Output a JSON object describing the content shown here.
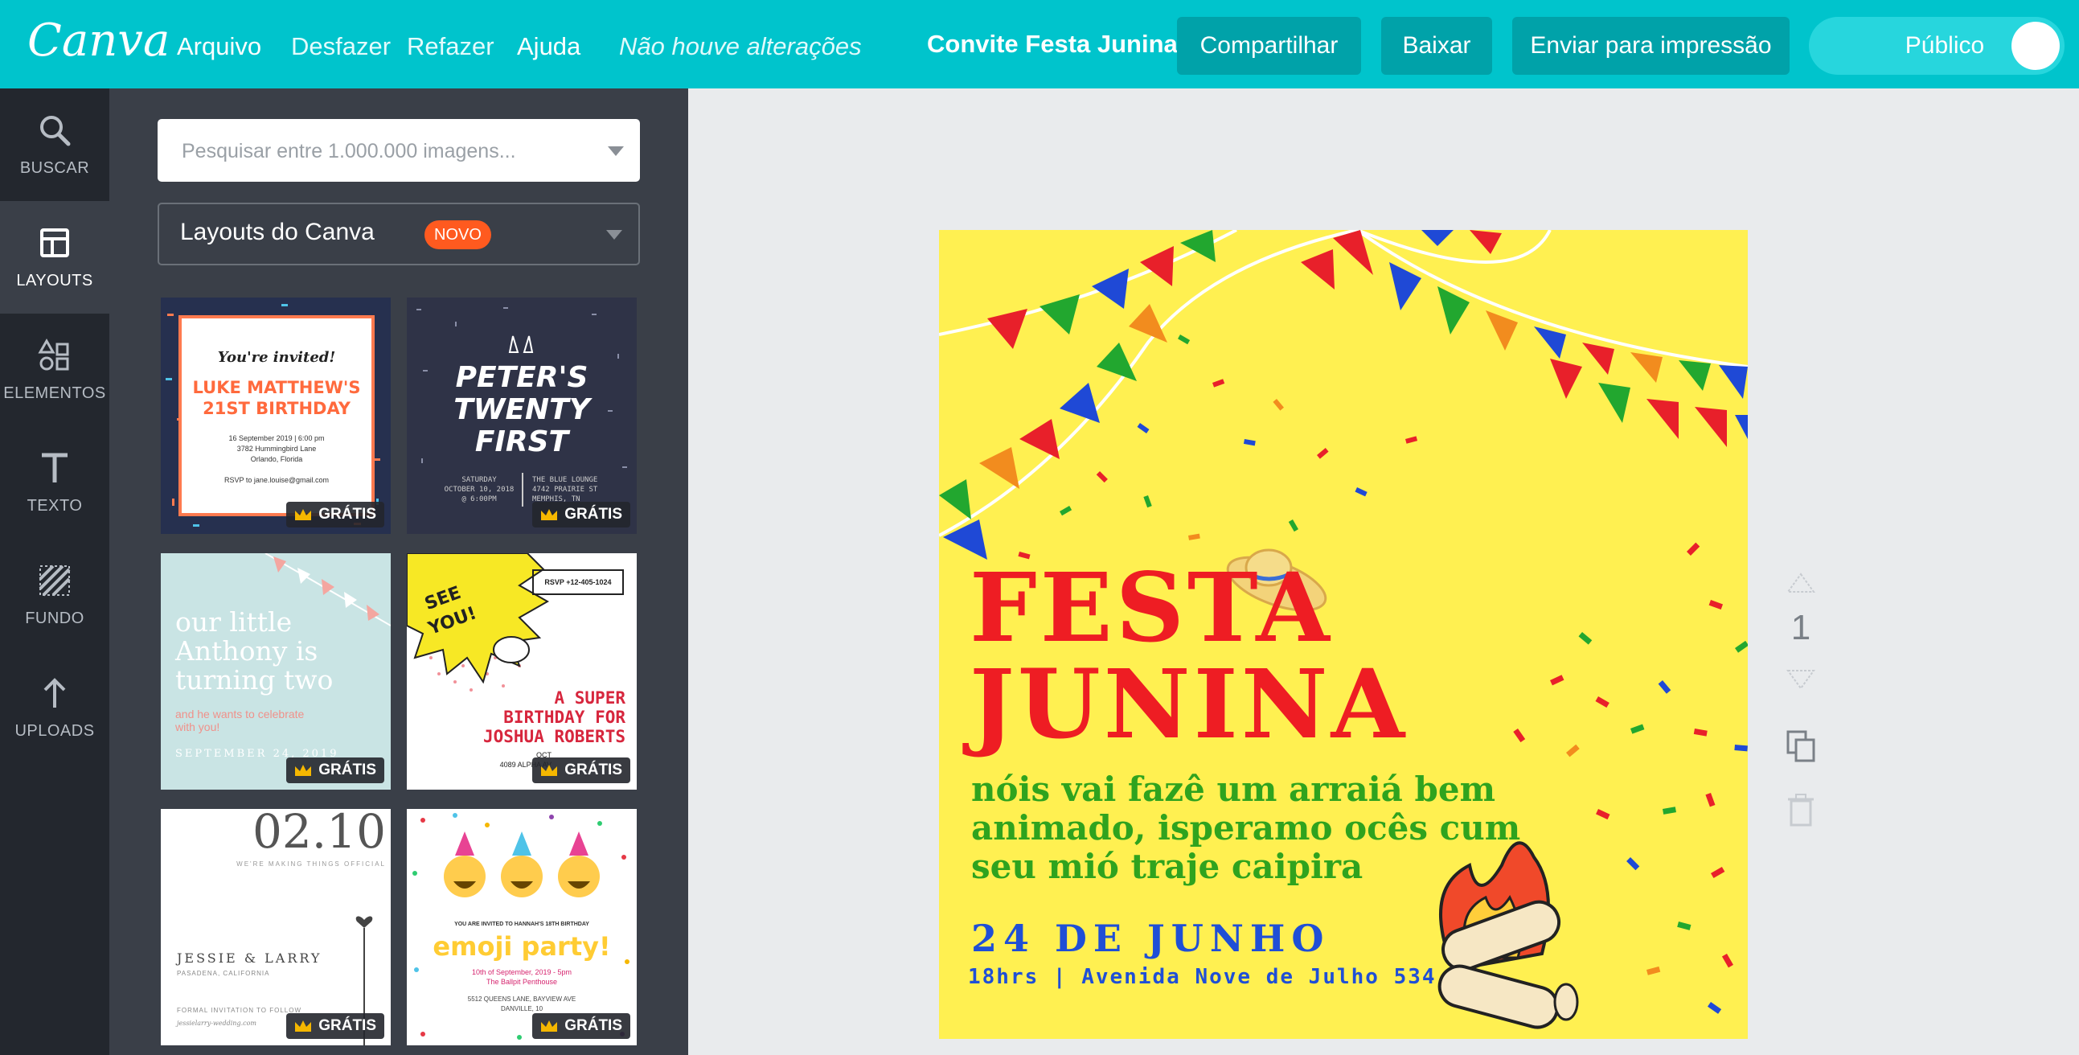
{
  "topbar": {
    "logo": "Canva",
    "menu": [
      "Arquivo",
      "Desfazer",
      "Refazer",
      "Ajuda"
    ],
    "status": "Não houve alterações",
    "doc_title": "Convite Festa Junina",
    "buttons": {
      "share": "Compartilhar",
      "download": "Baixar",
      "print": "Enviar para impressão"
    },
    "visibility": "Público"
  },
  "rail": [
    {
      "label": "BUSCAR",
      "icon": "search-icon"
    },
    {
      "label": "LAYOUTS",
      "icon": "layouts-icon"
    },
    {
      "label": "ELEMENTOS",
      "icon": "elements-icon"
    },
    {
      "label": "TEXTO",
      "icon": "text-icon"
    },
    {
      "label": "FUNDO",
      "icon": "background-icon"
    },
    {
      "label": "UPLOADS",
      "icon": "upload-icon"
    }
  ],
  "panel": {
    "search_placeholder": "Pesquisar entre 1.000.000 imagens...",
    "layouts_label": "Layouts do Canva",
    "new_badge": "NOVO",
    "free_label": "GRÁTIS",
    "templates": [
      {
        "lines": [
          "You're invited!",
          "LUKE MATTHEW'S",
          "21ST BIRTHDAY",
          "16 September 2019 | 6:00 pm",
          "3782 Hummingbird Lane",
          "Orlando, Florida",
          "RSVP to jane.louise@gmail.com"
        ]
      },
      {
        "lines": [
          "PETER'S",
          "TWENTY",
          "FIRST",
          "SATURDAY",
          "OCTOBER 10, 2018",
          "@ 6:00PM",
          "THE BLUE LOUNGE",
          "4742 PRAIRIE ST",
          "MEMPHIS, TN"
        ]
      },
      {
        "lines": [
          "our little",
          "Anthony is",
          "turning two",
          "and he wants to celebrate",
          "with you!",
          "SEPTEMBER 24, 2019"
        ]
      },
      {
        "lines": [
          "SEE",
          "YOU!",
          "RSVP +12-405-1024",
          "A SUPER",
          "BIRTHDAY FOR",
          "JOSHUA ROBERTS",
          "OCT",
          "4089 ALPHA AV"
        ]
      },
      {
        "lines": [
          "02.10",
          "WE'RE MAKING THINGS OFFICIAL",
          "JESSIE & LARRY",
          "PASADENA, CALIFORNIA",
          "FORMAL INVITATION TO FOLLOW",
          "jessielarry-wedding.com"
        ]
      },
      {
        "lines": [
          "YOU ARE INVITED TO HANNAH'S 18TH BIRTHDAY",
          "emoji party!",
          "10th of September, 2019 - 5pm",
          "The Ballpit Penthouse",
          "5512 QUEENS LANE, BAYVIEW AVE",
          "DANVILLE, 10"
        ]
      }
    ]
  },
  "poster": {
    "title_line1": "FESTA",
    "title_line2": "JUNINA",
    "body": [
      "nóis vai fazê um arraiá bem",
      "animado, isperamo ocês cum",
      "seu mió traje caipira"
    ],
    "date": "24 DE JUNHO",
    "details": "18hrs | Avenida Nove de Julho 534",
    "colors": {
      "background": "#fff051",
      "title": "#ee1d23",
      "body": "#2fa31e",
      "date": "#1f4fd6"
    }
  },
  "page_controls": {
    "page_number": "1"
  }
}
